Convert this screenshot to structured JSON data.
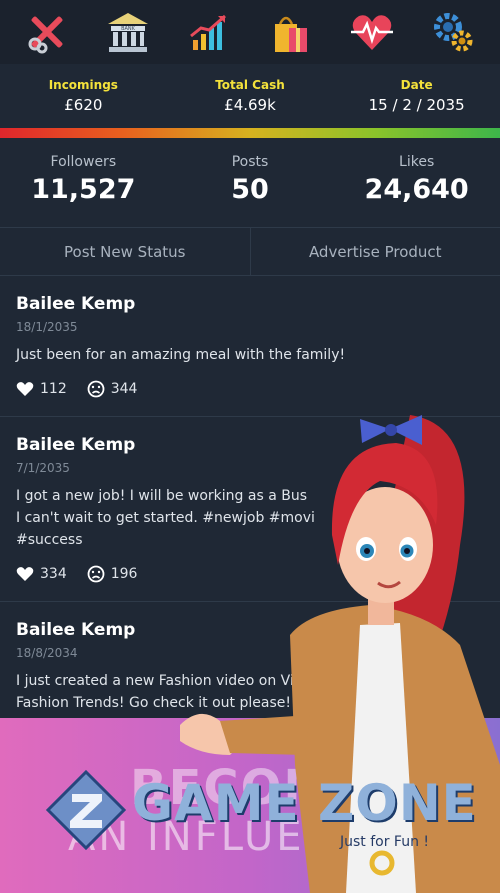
{
  "toolbar": {
    "icons": [
      "tools-icon",
      "bank-icon",
      "growth-chart-icon",
      "shopping-bag-icon",
      "heart-health-icon",
      "settings-gears-icon"
    ],
    "bank_label": "BANK"
  },
  "finance": {
    "incomings_label": "Incomings",
    "incomings_value": "£620",
    "total_cash_label": "Total Cash",
    "total_cash_value": "£4.69k",
    "date_label": "Date",
    "date_value": "15 / 2 / 2035",
    "progress_gradient": [
      "#e0262c",
      "#e8621e",
      "#d7b21f",
      "#8bc42a",
      "#3db64a"
    ]
  },
  "social": {
    "followers_label": "Followers",
    "followers_value": "11,527",
    "posts_label": "Posts",
    "posts_value": "50",
    "likes_label": "Likes",
    "likes_value": "24,640"
  },
  "actions": {
    "post_status_label": "Post New Status",
    "advertise_label": "Advertise Product"
  },
  "posts": [
    {
      "name": "Bailee Kemp",
      "date": "18/1/2035",
      "text": "Just been for an amazing meal with the family!",
      "likes": "112",
      "dislikes": "344"
    },
    {
      "name": "Bailee Kemp",
      "date": "7/1/2035",
      "text": "I got a new job! I will be working as a Bus\nI can't wait to get started. #newjob #movi\n#success",
      "likes": "334",
      "dislikes": "196"
    },
    {
      "name": "Bailee Kemp",
      "date": "18/8/2034",
      "text": "I just created a new Fashion video on Vid\nFashion Trends! Go check it out please! #"
    }
  ],
  "banner": {
    "line1": "BECOME",
    "line2": "AN INFLUENCER",
    "logo_text": "GAME ZONE",
    "logo_tagline": "Just for Fun !"
  },
  "colors": {
    "background": "#1f2835",
    "header": "#1b222d",
    "accent_yellow": "#f4e23b",
    "banner_pink": "#e06bbd",
    "banner_purple": "#8a6fd1"
  }
}
